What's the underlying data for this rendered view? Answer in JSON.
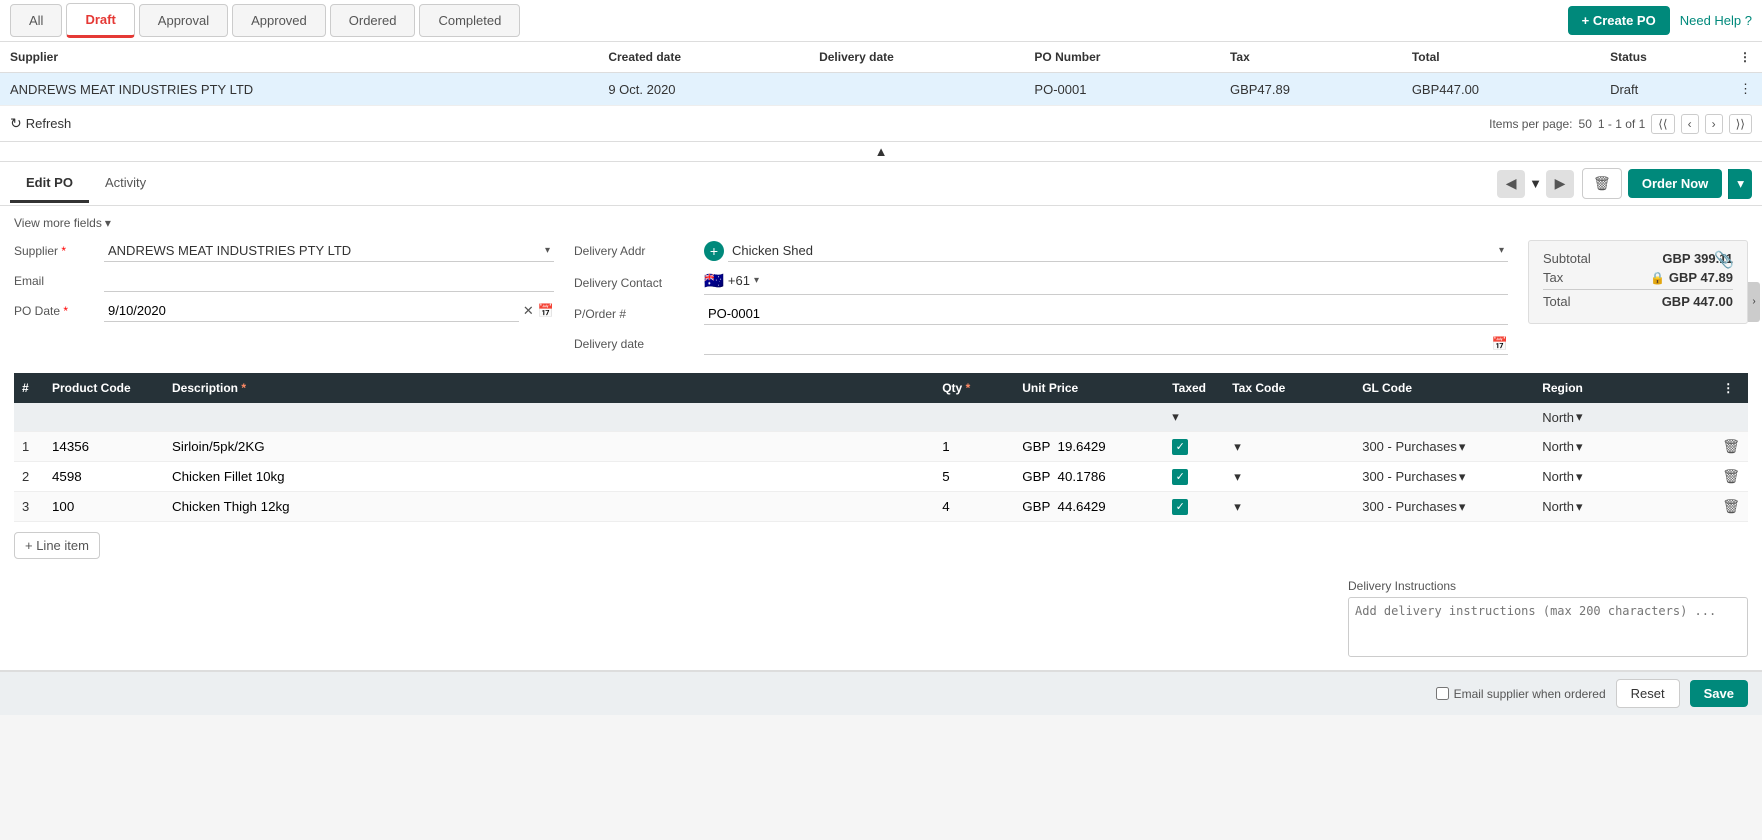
{
  "tabs": {
    "all": "All",
    "draft": "Draft",
    "approval": "Approval",
    "approved": "Approved",
    "ordered": "Ordered",
    "completed": "Completed",
    "active": "draft"
  },
  "header": {
    "create_po": "+ Create PO",
    "need_help": "Need Help ?"
  },
  "list": {
    "columns": [
      "Supplier",
      "Created date",
      "Delivery date",
      "PO Number",
      "Tax",
      "Total",
      "Status"
    ],
    "rows": [
      {
        "supplier": "ANDREWS MEAT INDUSTRIES PTY LTD",
        "created_date": "9 Oct. 2020",
        "delivery_date": "",
        "po_number": "PO-0001",
        "tax": "GBP47.89",
        "total": "GBP447.00",
        "status": "Draft"
      }
    ]
  },
  "toolbar": {
    "refresh": "Refresh",
    "items_per_page": "Items per page:",
    "per_page_value": "50",
    "pagination": "1 - 1 of 1"
  },
  "edit_po": {
    "tab_edit": "Edit PO",
    "tab_activity": "Activity",
    "delete_btn": "🗑",
    "order_now": "Order Now",
    "view_more": "View more fields",
    "supplier_label": "Supplier",
    "supplier_value": "ANDREWS MEAT INDUSTRIES PTY LTD",
    "email_label": "Email",
    "email_value": "",
    "po_date_label": "PO Date",
    "po_date_value": "9/10/2020",
    "delivery_addr_label": "Delivery Addr",
    "delivery_addr_value": "Chicken Shed",
    "delivery_contact_label": "Delivery Contact",
    "delivery_contact_flag": "🇦🇺",
    "delivery_contact_code": "+61",
    "p_order_label": "P/Order #",
    "p_order_value": "PO-0001",
    "delivery_date_label": "Delivery date",
    "delivery_date_value": "",
    "subtotal_label": "Subtotal",
    "subtotal_value": "GBP 399.11",
    "tax_label": "Tax",
    "tax_value": "GBP  47.89",
    "total_label": "Total",
    "total_value": "GBP 447.00"
  },
  "line_items": {
    "columns": {
      "num": "#",
      "product_code": "Product Code",
      "description": "Description",
      "qty": "Qty",
      "unit_price": "Unit Price",
      "taxed": "Taxed",
      "tax_code": "Tax Code",
      "gl_code": "GL Code",
      "region": "Region"
    },
    "filter_row": {
      "region_filter": "North"
    },
    "rows": [
      {
        "num": "1",
        "product_code": "14356",
        "description": "Sirloin/5pk/2KG",
        "qty": "1",
        "unit_price": "GBP  19.6429",
        "taxed": true,
        "tax_code": "",
        "gl_code": "300 - Purchases",
        "region": "North"
      },
      {
        "num": "2",
        "product_code": "4598",
        "description": "Chicken Fillet 10kg",
        "qty": "5",
        "unit_price": "GBP  40.1786",
        "taxed": true,
        "tax_code": "",
        "gl_code": "300 - Purchases",
        "region": "North"
      },
      {
        "num": "3",
        "product_code": "100",
        "description": "Chicken Thigh 12kg",
        "qty": "4",
        "unit_price": "GBP  44.6429",
        "taxed": true,
        "tax_code": "",
        "gl_code": "300 - Purchases",
        "region": "North"
      }
    ],
    "add_line": "+ Line item"
  },
  "delivery_instructions": {
    "label": "Delivery Instructions",
    "placeholder": "Add delivery instructions (max 200 characters) ..."
  },
  "footer": {
    "email_check_label": "Email supplier when ordered",
    "reset": "Reset",
    "save": "Save"
  }
}
